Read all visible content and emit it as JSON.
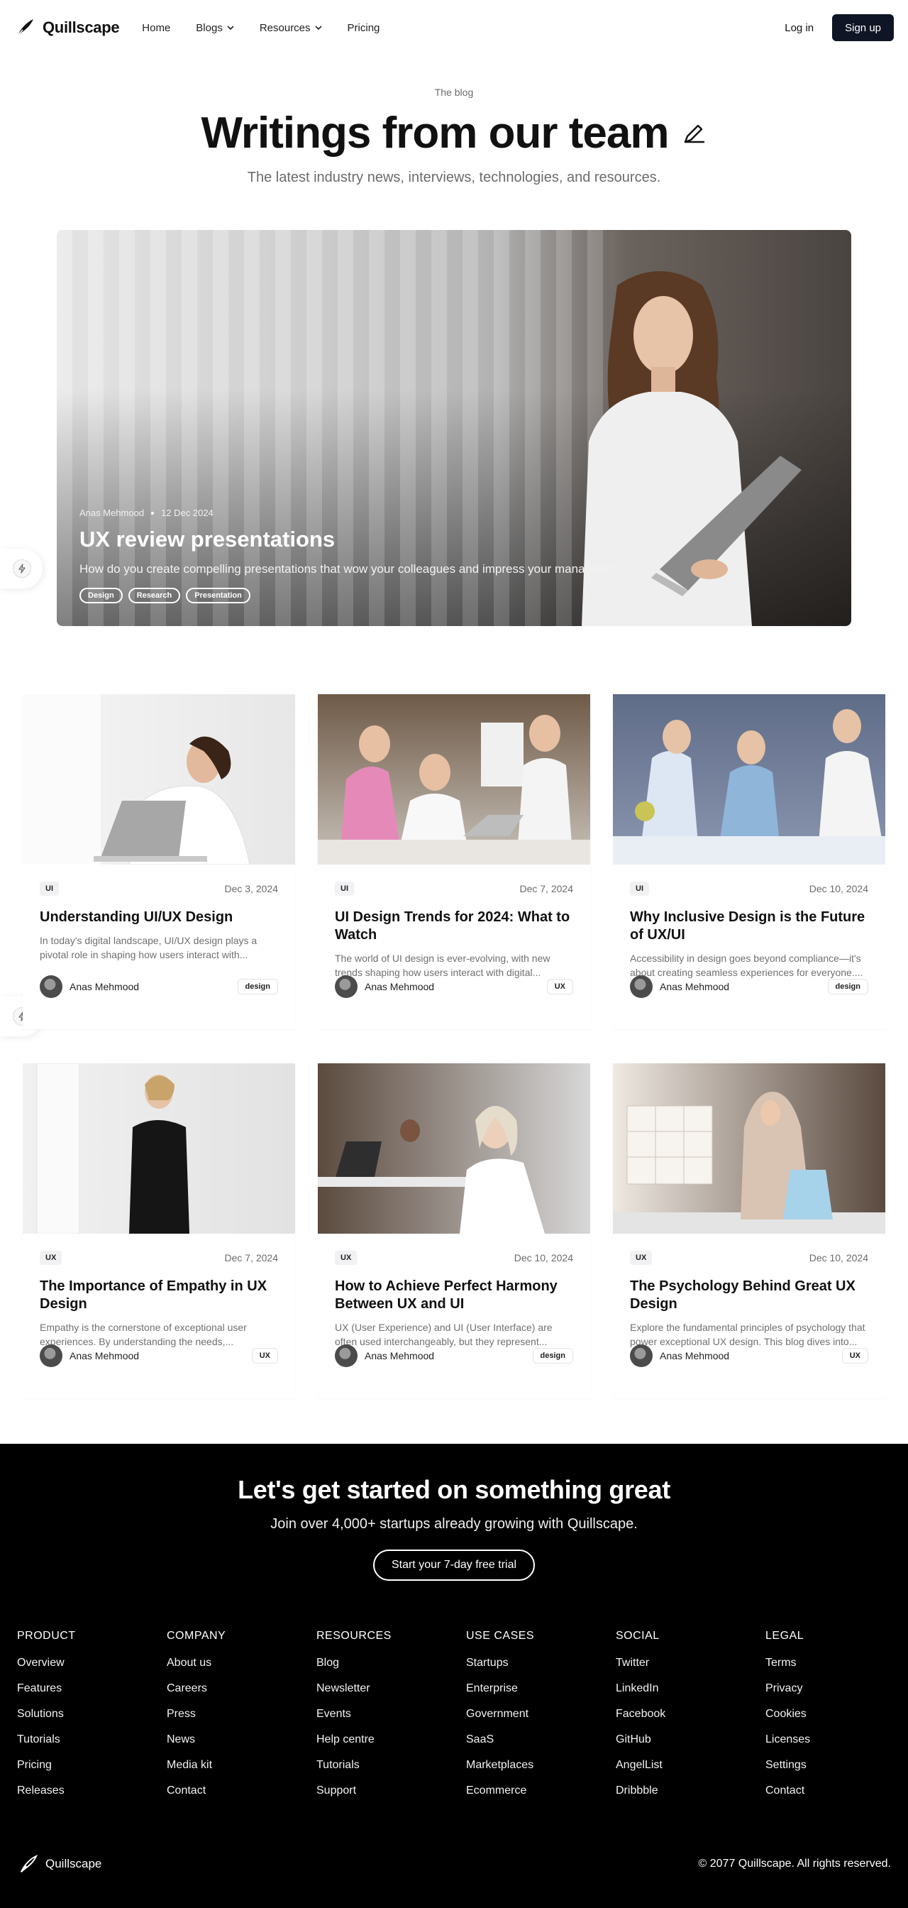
{
  "brand": {
    "name": "Quillscape"
  },
  "nav": {
    "links": [
      {
        "label": "Home"
      },
      {
        "label": "Blogs"
      },
      {
        "label": "Resources"
      },
      {
        "label": "Pricing"
      }
    ],
    "login": "Log in",
    "signup": "Sign up"
  },
  "hero": {
    "eyebrow": "The blog",
    "title": "Writings from our team",
    "subtitle": "The latest industry news, interviews, technologies, and resources."
  },
  "featured": {
    "author": "Anas Mehmood",
    "date": "12 Dec 2024",
    "title": "UX review presentations",
    "description": "How do you create compelling presentations that wow your colleagues and impress your managers?",
    "tags": [
      "Design",
      "Research",
      "Presentation"
    ]
  },
  "posts": [
    {
      "badge": "UI",
      "date": "Dec 3, 2024",
      "title": "Understanding UI/UX Design",
      "excerpt": "In today's digital landscape, UI/UX design plays a pivotal role in shaping how users interact with...",
      "author": "Anas Mehmood",
      "tag": "design"
    },
    {
      "badge": "UI",
      "date": "Dec 7, 2024",
      "title": "UI Design Trends for 2024: What to Watch",
      "excerpt": "The world of UI design is ever-evolving, with new trends shaping how users interact with digital...",
      "author": "Anas Mehmood",
      "tag": "UX"
    },
    {
      "badge": "UI",
      "date": "Dec 10, 2024",
      "title": "Why Inclusive Design is the Future of UX/UI",
      "excerpt": "Accessibility in design goes beyond compliance—it's about creating seamless experiences for everyone....",
      "author": "Anas Mehmood",
      "tag": "design"
    },
    {
      "badge": "UX",
      "date": "Dec 7, 2024",
      "title": "The Importance of Empathy in UX Design",
      "excerpt": "Empathy is the cornerstone of exceptional user experiences. By understanding the needs,...",
      "author": "Anas Mehmood",
      "tag": "UX"
    },
    {
      "badge": "UX",
      "date": "Dec 10, 2024",
      "title": "How to Achieve Perfect Harmony Between UX and UI",
      "excerpt": "UX (User Experience) and UI (User Interface) are often used interchangeably, but they represent...",
      "author": "Anas Mehmood",
      "tag": "design"
    },
    {
      "badge": "UX",
      "date": "Dec 10, 2024",
      "title": "The Psychology Behind Great UX Design",
      "excerpt": "Explore the fundamental principles of psychology that power exceptional UX design. This blog dives into...",
      "author": "Anas Mehmood",
      "tag": "UX"
    }
  ],
  "cta": {
    "title": "Let's get started on something great",
    "subtitle": "Join over 4,000+ startups already growing with Quillscape.",
    "button": "Start your 7-day free trial"
  },
  "footer": {
    "columns": [
      {
        "title": "PRODUCT",
        "links": [
          "Overview",
          "Features",
          "Solutions",
          "Tutorials",
          "Pricing",
          "Releases"
        ]
      },
      {
        "title": "COMPANY",
        "links": [
          "About us",
          "Careers",
          "Press",
          "News",
          "Media kit",
          "Contact"
        ]
      },
      {
        "title": "RESOURCES",
        "links": [
          "Blog",
          "Newsletter",
          "Events",
          "Help centre",
          "Tutorials",
          "Support"
        ]
      },
      {
        "title": "USE CASES",
        "links": [
          "Startups",
          "Enterprise",
          "Government",
          "SaaS",
          "Marketplaces",
          "Ecommerce"
        ]
      },
      {
        "title": "SOCIAL",
        "links": [
          "Twitter",
          "LinkedIn",
          "Facebook",
          "GitHub",
          "AngelList",
          "Dribbble"
        ]
      },
      {
        "title": "LEGAL",
        "links": [
          "Terms",
          "Privacy",
          "Cookies",
          "Licenses",
          "Settings",
          "Contact"
        ]
      }
    ],
    "brand": "Quillscape",
    "copyright": "© 2077 Quillscape. All rights reserved."
  }
}
